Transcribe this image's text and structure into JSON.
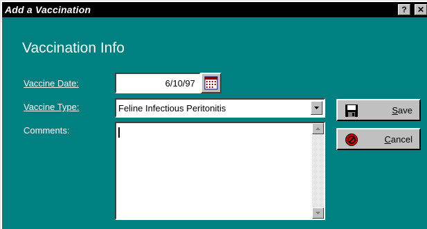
{
  "window": {
    "title": "Add a Vaccination",
    "help_label": "?",
    "close_label": "✕"
  },
  "form": {
    "section_title": "Vaccination Info",
    "date_label": "Vaccine Date:",
    "date_value": "6/10/97",
    "type_label": "Vaccine Type:",
    "type_value": "Feline Infectious Peritonitis",
    "comments_label": "Comments:",
    "comments_value": ""
  },
  "buttons": {
    "save_mnemonic": "S",
    "save_rest": "ave",
    "cancel_mnemonic": "C",
    "cancel_rest": "ancel"
  },
  "icons": {
    "calendar": "calendar-icon",
    "dropdown": "chevron-down-icon",
    "save": "floppy-disk-icon",
    "cancel": "stop-icon"
  },
  "colors": {
    "dialog_background": "#008080",
    "titlebar": "#000000",
    "button_face": "#c0c0c0",
    "cancel_icon": "#e00000"
  }
}
